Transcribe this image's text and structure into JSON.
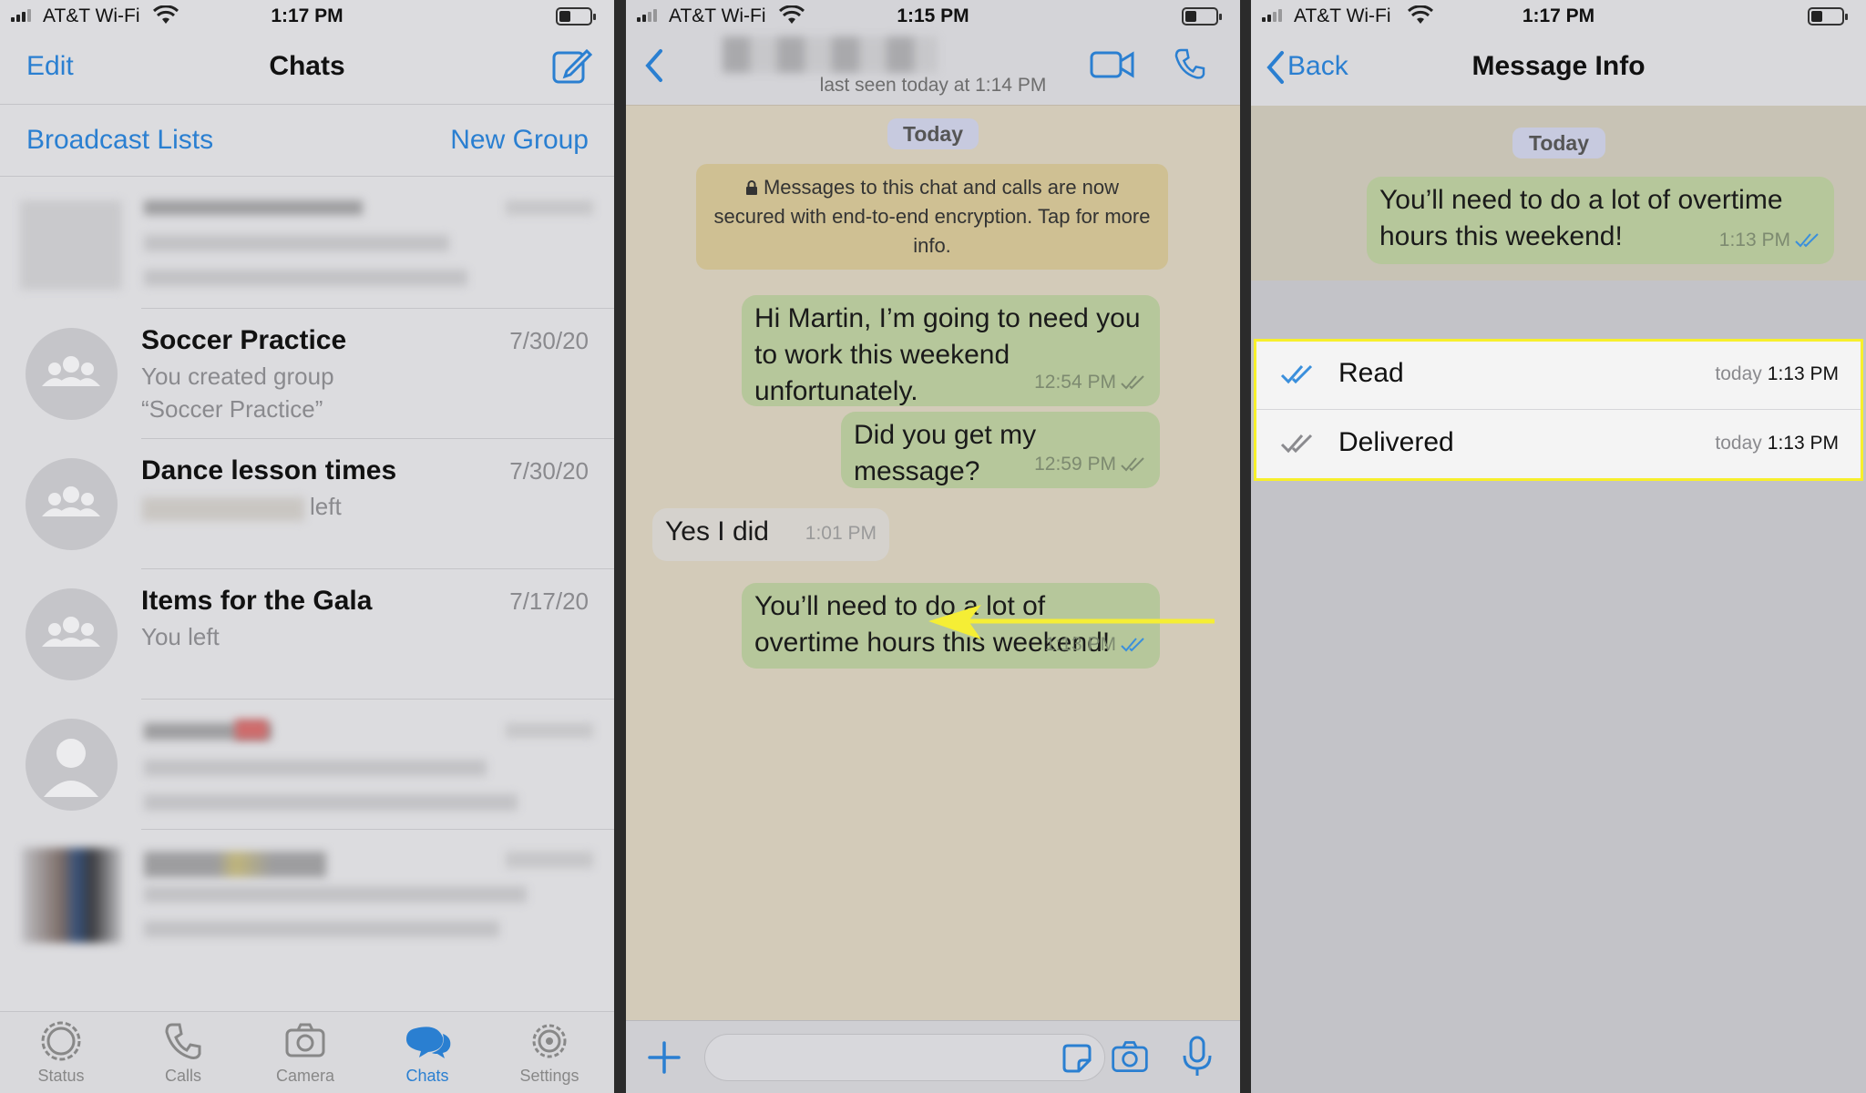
{
  "status_left": {
    "carrier": "AT&T Wi-Fi",
    "time": "1:17 PM"
  },
  "status_mid": {
    "carrier": "AT&T Wi-Fi",
    "time": "1:15 PM"
  },
  "status_right": {
    "carrier": "AT&T Wi-Fi",
    "time": "1:17 PM"
  },
  "chats": {
    "edit_label": "Edit",
    "title": "Chats",
    "broadcast_label": "Broadcast Lists",
    "new_group_label": "New Group",
    "rows": [
      {
        "name": "Soccer Practice",
        "date": "7/30/20",
        "line1": "You created group",
        "line2": "“Soccer Practice”"
      },
      {
        "name": "Dance lesson times",
        "date": "7/30/20",
        "line1": "left"
      },
      {
        "name": "Items for the Gala",
        "date": "7/17/20",
        "line1": "You left"
      }
    ],
    "tabs": [
      {
        "label": "Status",
        "icon": "status-icon"
      },
      {
        "label": "Calls",
        "icon": "phone-icon"
      },
      {
        "label": "Camera",
        "icon": "camera-icon"
      },
      {
        "label": "Chats",
        "icon": "chats-icon"
      },
      {
        "label": "Settings",
        "icon": "gear-icon"
      }
    ]
  },
  "conversation": {
    "last_seen": "last seen today at 1:14 PM",
    "day_chip": "Today",
    "system_message": "Messages to this chat and calls are now secured with end-to-end encryption. Tap for more info.",
    "messages": [
      {
        "direction": "out",
        "text": "Hi Martin, I’m going to need you to work this weekend unfortunately.",
        "time": "12:54 PM",
        "status": "delivered"
      },
      {
        "direction": "out",
        "text": "Did you get my message?",
        "time": "12:59 PM",
        "status": "delivered"
      },
      {
        "direction": "in",
        "text": "Yes I did",
        "time": "1:01 PM"
      },
      {
        "direction": "out",
        "text": "You’ll need to do a lot of overtime hours this weekend!",
        "time": "1:13 PM",
        "status": "read"
      }
    ]
  },
  "message_info": {
    "back_label": "Back",
    "title": "Message Info",
    "day_chip": "Today",
    "message_text": "You’ll need to do a lot of overtime hours this weekend!",
    "message_time": "1:13 PM",
    "rows": [
      {
        "label": "Read",
        "day": "today",
        "time": "1:13 PM"
      },
      {
        "label": "Delivered",
        "day": "today",
        "time": "1:13 PM"
      }
    ]
  },
  "colors": {
    "accent": "#2a7fd1",
    "outgoing_bubble": "#b6c79b",
    "highlight": "#f7ef2c",
    "read_ticks": "#3a8fdc"
  }
}
